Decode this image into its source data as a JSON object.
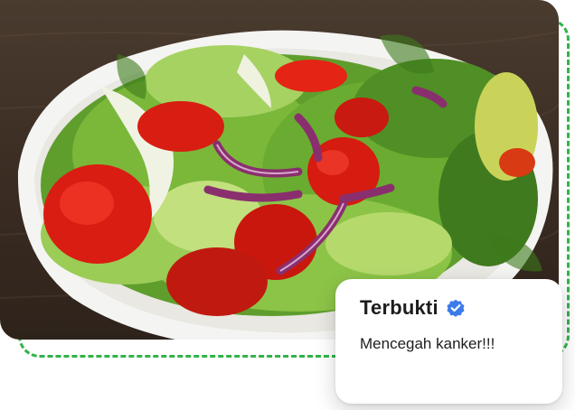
{
  "card": {
    "title": "Terbukti",
    "text": "Mencegah kanker!!!",
    "badge_icon": "verified-check-icon",
    "badge_color": "#3d7be8"
  },
  "frame": {
    "accent_color": "#31b34a"
  },
  "image": {
    "subject_icon": "salad-bowl-photo"
  }
}
